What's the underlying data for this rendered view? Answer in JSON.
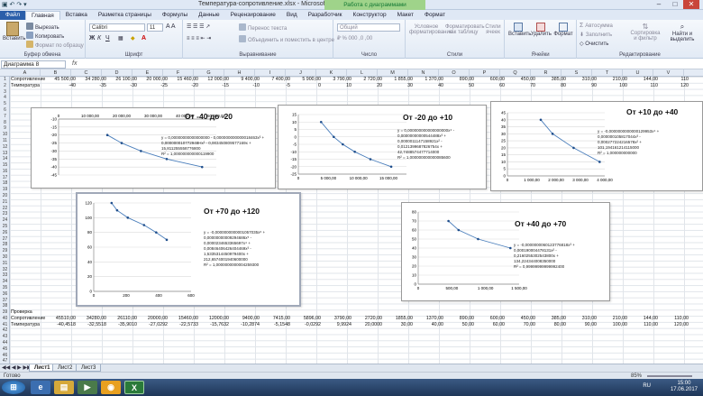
{
  "window": {
    "title": "Температура-сопротивление.xlsx - Microsoft Excel",
    "context_tab": "Работа с диаграммами"
  },
  "tabs": [
    "Файл",
    "Главная",
    "Вставка",
    "Разметка страницы",
    "Формулы",
    "Данные",
    "Рецензирование",
    "Вид",
    "Разработчик",
    "Конструктор",
    "Макет",
    "Формат"
  ],
  "ribbon": {
    "clipboard": {
      "paste": "Вставить",
      "cut": "Вырезать",
      "copy": "Копировать",
      "format_painter": "Формат по образцу",
      "name": "Буфер обмена"
    },
    "font": {
      "family": "Calibri",
      "size": "11",
      "name": "Шрифт"
    },
    "alignment": {
      "wrap": "Перенос текста",
      "merge": "Объединить и поместить в центре",
      "name": "Выравнивание"
    },
    "number": {
      "format": "Общий",
      "name": "Число"
    },
    "styles": {
      "cond": "Условное форматирование",
      "table": "Форматировать как таблицу",
      "cell": "Стили ячеек",
      "name": "Стили"
    },
    "cells": {
      "insert": "Вставить",
      "delete": "Удалить",
      "format": "Формат",
      "name": "Ячейки"
    },
    "editing": {
      "autosum": "Автосумма",
      "fill": "Заполнить",
      "clear": "Очистить",
      "sort": "Сортировка и фильтр",
      "find": "Найти и выделить",
      "name": "Редактирование"
    }
  },
  "formula_bar": {
    "name_box": "Диаграмма 8",
    "fx": "fx"
  },
  "columns": [
    "A",
    "B",
    "C",
    "D",
    "E",
    "F",
    "G",
    "H",
    "I",
    "J",
    "K",
    "L",
    "M",
    "N",
    "O",
    "P",
    "Q",
    "R",
    "S",
    "T",
    "U",
    "V",
    "W"
  ],
  "rows": {
    "row1": {
      "label": "Сопротивление",
      "values": [
        "45 500,00",
        "34 280,00",
        "26 100,00",
        "20 000,00",
        "15 460,00",
        "12 000,00",
        "9 400,00",
        "7 400,00",
        "5 900,00",
        "3 790,00",
        "2 720,00",
        "1 855,00",
        "1 370,00",
        "890,00",
        "600,00",
        "450,00",
        "385,00",
        "310,00",
        "210,00",
        "144,00",
        "110"
      ]
    },
    "row2": {
      "label": "Температура",
      "values": [
        "-40",
        "-35",
        "-30",
        "-25",
        "-20",
        "-15",
        "-10",
        "-5",
        "0",
        "10",
        "20",
        "30",
        "40",
        "50",
        "60",
        "70",
        "80",
        "90",
        "100",
        "110",
        "120"
      ]
    },
    "row32": {
      "label": "Проверка"
    },
    "row33": {
      "label": "Сопротивление",
      "values": [
        "45510,00",
        "34280,00",
        "26110,00",
        "20000,00",
        "15460,00",
        "12000,00",
        "9400,00",
        "7415,00",
        "5896,00",
        "3790,00",
        "2720,00",
        "1855,00",
        "1370,00",
        "890,00",
        "600,00",
        "450,00",
        "385,00",
        "310,00",
        "210,00",
        "144,00",
        "110,00"
      ]
    },
    "row34": {
      "label": "Температура",
      "values": [
        "-40,4518",
        "-32,5518",
        "-35,9010",
        "-27,0292",
        "-22,5733",
        "-15,7632",
        "-10,2874",
        "-5,1548",
        "-0,0292",
        "9,9924",
        "20,0000",
        "30,00",
        "40,00",
        "50,00",
        "60,00",
        "70,00",
        "80,00",
        "90,00",
        "100,00",
        "110,00",
        "120,00"
      ]
    }
  },
  "charts": [
    {
      "title": "От -40 до -20",
      "equation": [
        "y = 0,00000000000000000 - 0,000000000000018463x³ +",
        "0,000000010772948Hx² - 0,003450809577169x +",
        "15,811255558776800",
        "R² = 1,000000000000119900"
      ],
      "x_ticks": [
        "0",
        "10 000,00",
        "20 000,00",
        "30 000,00",
        "40 000,00",
        "50 000,00"
      ],
      "y_ticks": [
        "-10",
        "-15",
        "-20",
        "-25",
        "-30",
        "-35",
        "-40",
        "-45"
      ],
      "chart_data": {
        "type": "scatter",
        "x": [
          15460,
          20000,
          26100,
          34280,
          45500
        ],
        "y": [
          -20,
          -25,
          -30,
          -35,
          -40
        ],
        "xlim": [
          0,
          50000
        ],
        "ylim": [
          -45,
          -10
        ]
      }
    },
    {
      "title": "От -20 до +10",
      "equation": [
        "y = 0,000000000000000000x⁴ -",
        "0,00000000000544488x³ +",
        "0,0000011147158921x² -",
        "0,0121399687826754x +",
        "42,7488574477714000",
        "R² = 1,000000000000085600"
      ],
      "x_ticks": [
        "0",
        "5 000,00",
        "10 000,00",
        "15 000,00"
      ],
      "y_ticks": [
        "15",
        "10",
        "5",
        "0",
        "-5",
        "-10",
        "-15",
        "-20",
        "-25"
      ],
      "chart_data": {
        "type": "scatter",
        "x": [
          3790,
          5900,
          7400,
          9400,
          12000,
          15460
        ],
        "y": [
          10,
          0,
          -5,
          -10,
          -15,
          -20
        ],
        "xlim": [
          0,
          18000
        ],
        "ylim": [
          -25,
          15
        ]
      }
    },
    {
      "title": "От +10 до +40",
      "equation": [
        "y = -0,0000000000000129953x⁴ +",
        "0,000000105817044x³ -",
        "0,000277224216578x² +",
        "101,194161214115000",
        "R² = 1,000000000000"
      ],
      "x_ticks": [
        "0",
        "1 000,00",
        "2 000,00",
        "3 000,00",
        "4 000,00"
      ],
      "y_ticks": [
        "45",
        "40",
        "35",
        "30",
        "25",
        "20",
        "15",
        "10",
        "5",
        "0"
      ],
      "chart_data": {
        "type": "scatter",
        "x": [
          1370,
          1855,
          2720,
          3790
        ],
        "y": [
          40,
          30,
          20,
          10
        ],
        "xlim": [
          0,
          4000
        ],
        "ylim": [
          0,
          45
        ]
      }
    },
    {
      "title": "От +70 до +120",
      "equation": [
        "y = -0,0000000000001057035x⁶ +",
        "0,00000000009294686x⁵ -",
        "0,0000234653365697x⁴ +",
        "0,00846406426404469x³ -",
        "1,5335314450979400x +",
        "212,6574001940600000",
        "R² = 1,0000000000004259300"
      ],
      "x_ticks": [
        "0",
        "200",
        "400",
        "600"
      ],
      "y_ticks": [
        "120",
        "100",
        "80",
        "60",
        "40",
        "20",
        "0"
      ],
      "chart_data": {
        "type": "scatter",
        "x": [
          110,
          144,
          210,
          310,
          385,
          450
        ],
        "y": [
          120,
          110,
          100,
          90,
          80,
          70
        ],
        "xlim": [
          0,
          600
        ],
        "ylim": [
          0,
          120
        ]
      }
    },
    {
      "title": "От +40 до +70",
      "equation": [
        "y = -0,0000000060123776818x³ +",
        "0,000190004478131x² -",
        "0,2160255302543800x +",
        "134,224344008350000",
        "R² = 0,99999999999992400"
      ],
      "x_ticks": [
        "0",
        "500,00",
        "1 000,00",
        "1 500,00"
      ],
      "y_ticks": [
        "80",
        "70",
        "60",
        "50",
        "40",
        "30",
        "20",
        "10",
        "0"
      ],
      "chart_data": {
        "type": "scatter",
        "x": [
          450,
          600,
          890,
          1370
        ],
        "y": [
          70,
          60,
          50,
          40
        ],
        "xlim": [
          0,
          1500
        ],
        "ylim": [
          0,
          80
        ]
      }
    }
  ],
  "sheets": [
    "Лист1",
    "Лист2",
    "Лист3"
  ],
  "status": {
    "ready": "Готово",
    "zoom": "85%"
  },
  "taskbar": {
    "lang": "RU",
    "time": "15:00",
    "date": "17.06.2017"
  }
}
